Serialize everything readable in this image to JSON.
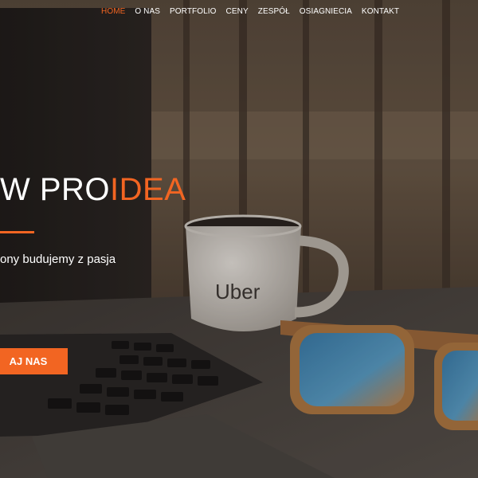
{
  "nav": {
    "items": [
      {
        "label": "HOME",
        "active": true
      },
      {
        "label": "O NAS",
        "active": false
      },
      {
        "label": "PORTFOLIO",
        "active": false
      },
      {
        "label": "CENY",
        "active": false
      },
      {
        "label": "ZESPÓŁ",
        "active": false
      },
      {
        "label": "OSIAGNIECIA",
        "active": false
      },
      {
        "label": "KONTAKT",
        "active": false
      }
    ],
    "active_color": "#f26522"
  },
  "hero": {
    "title_plain": "W PRO",
    "title_accent": "IDEA",
    "subtitle": "ony budujemy z pasja",
    "cta_label": "AJ NAS",
    "mug_text": "Uber"
  },
  "colors": {
    "accent": "#f26522",
    "text": "#ffffff",
    "background": "#2e2620"
  }
}
